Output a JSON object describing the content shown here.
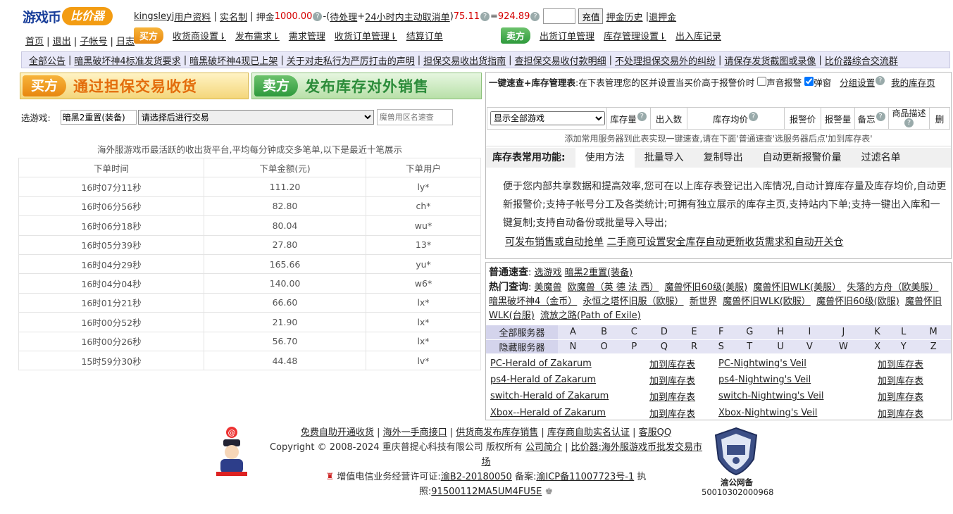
{
  "logo": {
    "text1": "游戏币",
    "text2": "比价器"
  },
  "nav_left": [
    "首页",
    "退出",
    "子帐号",
    "日志"
  ],
  "user_bar": {
    "username": "kingsleyj",
    "profile": "用户资料",
    "realname": "实名制",
    "deposit_label": "押金",
    "deposit_amount": "1000.00",
    "minus_open": "-(",
    "pending": "待处理",
    "plus": " + ",
    "cancel24": "24小时内主动取消单",
    "close_paren": ")",
    "amount2": "75.11",
    "equals": "=",
    "amount3": "924.89",
    "recharge": "充值",
    "history": "押金历史",
    "refund": "退押金"
  },
  "buy_tag": "买方",
  "buy_menu": [
    "收货商设置⇂",
    "发布需求⇂",
    "需求管理",
    "收货订单管理⇂",
    "结算订单"
  ],
  "sell_tag": "卖方",
  "sell_menu": [
    "出货订单管理",
    "库存管理设置⇂",
    "出入库记录"
  ],
  "notices": [
    "全部公告",
    "暗黑破坏神4标准发货要求",
    "暗黑破坏神4现已上架",
    "关于对走私行为严厉打击的声明",
    "担保交易收出货指南",
    "查担保交易收付款明细",
    "不处理担保交易外的纠纷",
    "请保存发货截图或录像",
    "比价器综合交流群"
  ],
  "banner_buy": {
    "tag": "买方",
    "text": "通过担保交易收货"
  },
  "banner_sell": {
    "tag": "卖方",
    "text": "发布库存对外销售"
  },
  "game_select": {
    "label": "选游戏:",
    "game": "暗黑2重置(装备)",
    "trade_option": "请选择后进行交易",
    "server_placeholder": "魔兽用区名速查"
  },
  "orders_caption": "海外服游戏币最活跃的收出货平台,平均每分钟成交多笔单,以下是最近十笔展示",
  "orders_headers": [
    "下单时间",
    "下单金额(元)",
    "下单用户"
  ],
  "orders": [
    [
      "16时07分11秒",
      "111.20",
      "ly*"
    ],
    [
      "16时06分56秒",
      "82.80",
      "ch*"
    ],
    [
      "16时06分18秒",
      "80.04",
      "wu*"
    ],
    [
      "16时05分39秒",
      "27.80",
      "13*"
    ],
    [
      "16时04分29秒",
      "165.66",
      "yu*"
    ],
    [
      "16时04分04秒",
      "140.00",
      "w6*"
    ],
    [
      "16时01分21秒",
      "66.60",
      "lx*"
    ],
    [
      "16时00分52秒",
      "21.90",
      "lx*"
    ],
    [
      "16时00分26秒",
      "56.70",
      "lx*"
    ],
    [
      "15时59分30秒",
      "44.48",
      "lv*"
    ]
  ],
  "quick": {
    "title": "一键速查+库存管理表",
    "desc": ":在下表管理您的区并设置当买价高于报警价时",
    "sound_alarm": "声音报警",
    "popup": "弹窗",
    "group_settings": "分组设置",
    "my_inventory": "我的库存页"
  },
  "inv_headers": {
    "show_all": "显示全部游戏",
    "stock": "库存量",
    "out": "出入数",
    "avg": "库存均价",
    "alarm_price": "报警价",
    "alarm_qty": "报警量",
    "memo": "备忘",
    "desc": "商品描述",
    "del": "删"
  },
  "inv_hint": "添加常用服务器到此表实现一键速查,请在下面'普通速查'选服务器后点'加到库存表'",
  "inv_tabs": [
    "库存表常用功能:",
    "使用方法",
    "批量导入",
    "复制导出",
    "自动更新报警价量",
    "过滤名单"
  ],
  "inv_desc": "便于您内部共享数据和提高效率,您可在以上库存表登记出入库情况,自动计算库存量及库存均价,自动更新报警价;支持子帐号分工及各类统计;可拥有独立展示的库存主页,支持站内下单;支持一键出入库和一键复制;支持自动备份或批量导入导出;",
  "inv_links": [
    "可发布销售或自动抢单",
    "二手商可设置安全库存自动更新收货需求和自动开关仓"
  ],
  "common_query": {
    "label": "普通速查",
    "select_game": "选游戏",
    "game": "暗黑2重置(装备)"
  },
  "hot_query": {
    "label": "热门查询",
    "items": [
      "美魔兽",
      "欧魔兽（英 德 法 西）",
      "魔兽怀旧60级(美服)",
      "魔兽怀旧WLK(美服）",
      "失落的方舟（欧美服）",
      "暗黑破坏神4（金币）",
      "永恒之塔怀旧服（欧服）",
      "新世界",
      "魔兽怀旧WLK(欧服）",
      "魔兽怀旧60级(欧服)",
      "魔兽怀旧WLK(台服)",
      "流放之路(Path of Exile)"
    ]
  },
  "letters": {
    "all_label": "全部服务器",
    "hidden_label": "隐藏服务器",
    "row1": [
      "A",
      "B",
      "C",
      "D",
      "E",
      "F",
      "G",
      "H",
      "I",
      "J",
      "K",
      "L",
      "M"
    ],
    "row2": [
      "N",
      "O",
      "P",
      "Q",
      "R",
      "S",
      "T",
      "U",
      "V",
      "W",
      "X",
      "Y",
      "Z"
    ]
  },
  "add_label": "加到库存表",
  "servers": [
    [
      "PC-Herald of Zakarum",
      "PC-Nightwing's Veil"
    ],
    [
      "ps4-Herald of Zakarum",
      "ps4-Nightwing's Veil"
    ],
    [
      "switch-Herald of Zakarum",
      "switch-Nightwing's Veil"
    ],
    [
      "Xbox--Herald of Zakarum",
      "Xbox-Nightwing's Veil"
    ]
  ],
  "footer": {
    "links": [
      "免费自助开通收货",
      "海外一手商接口",
      "供货商发布库存销售",
      "库存商自助实名认证",
      "客服QQ"
    ],
    "copyright": "Copyright © 2008-2024 重庆普提心科技有限公司 版权所有",
    "intro": "公司简介",
    "desc_link": "比价器:海外服游戏币批发交易市场",
    "license_label": "增值电信业务经营许可证:",
    "license": "渝B2-20180050",
    "icp_label": " 备案:",
    "icp": "渝ICP备11007723号-1",
    "biz_label": " 执照:",
    "biz": "91500112MA5UM4FU5E",
    "badge_title": "渝公网备",
    "badge_num": "50010302000968"
  }
}
